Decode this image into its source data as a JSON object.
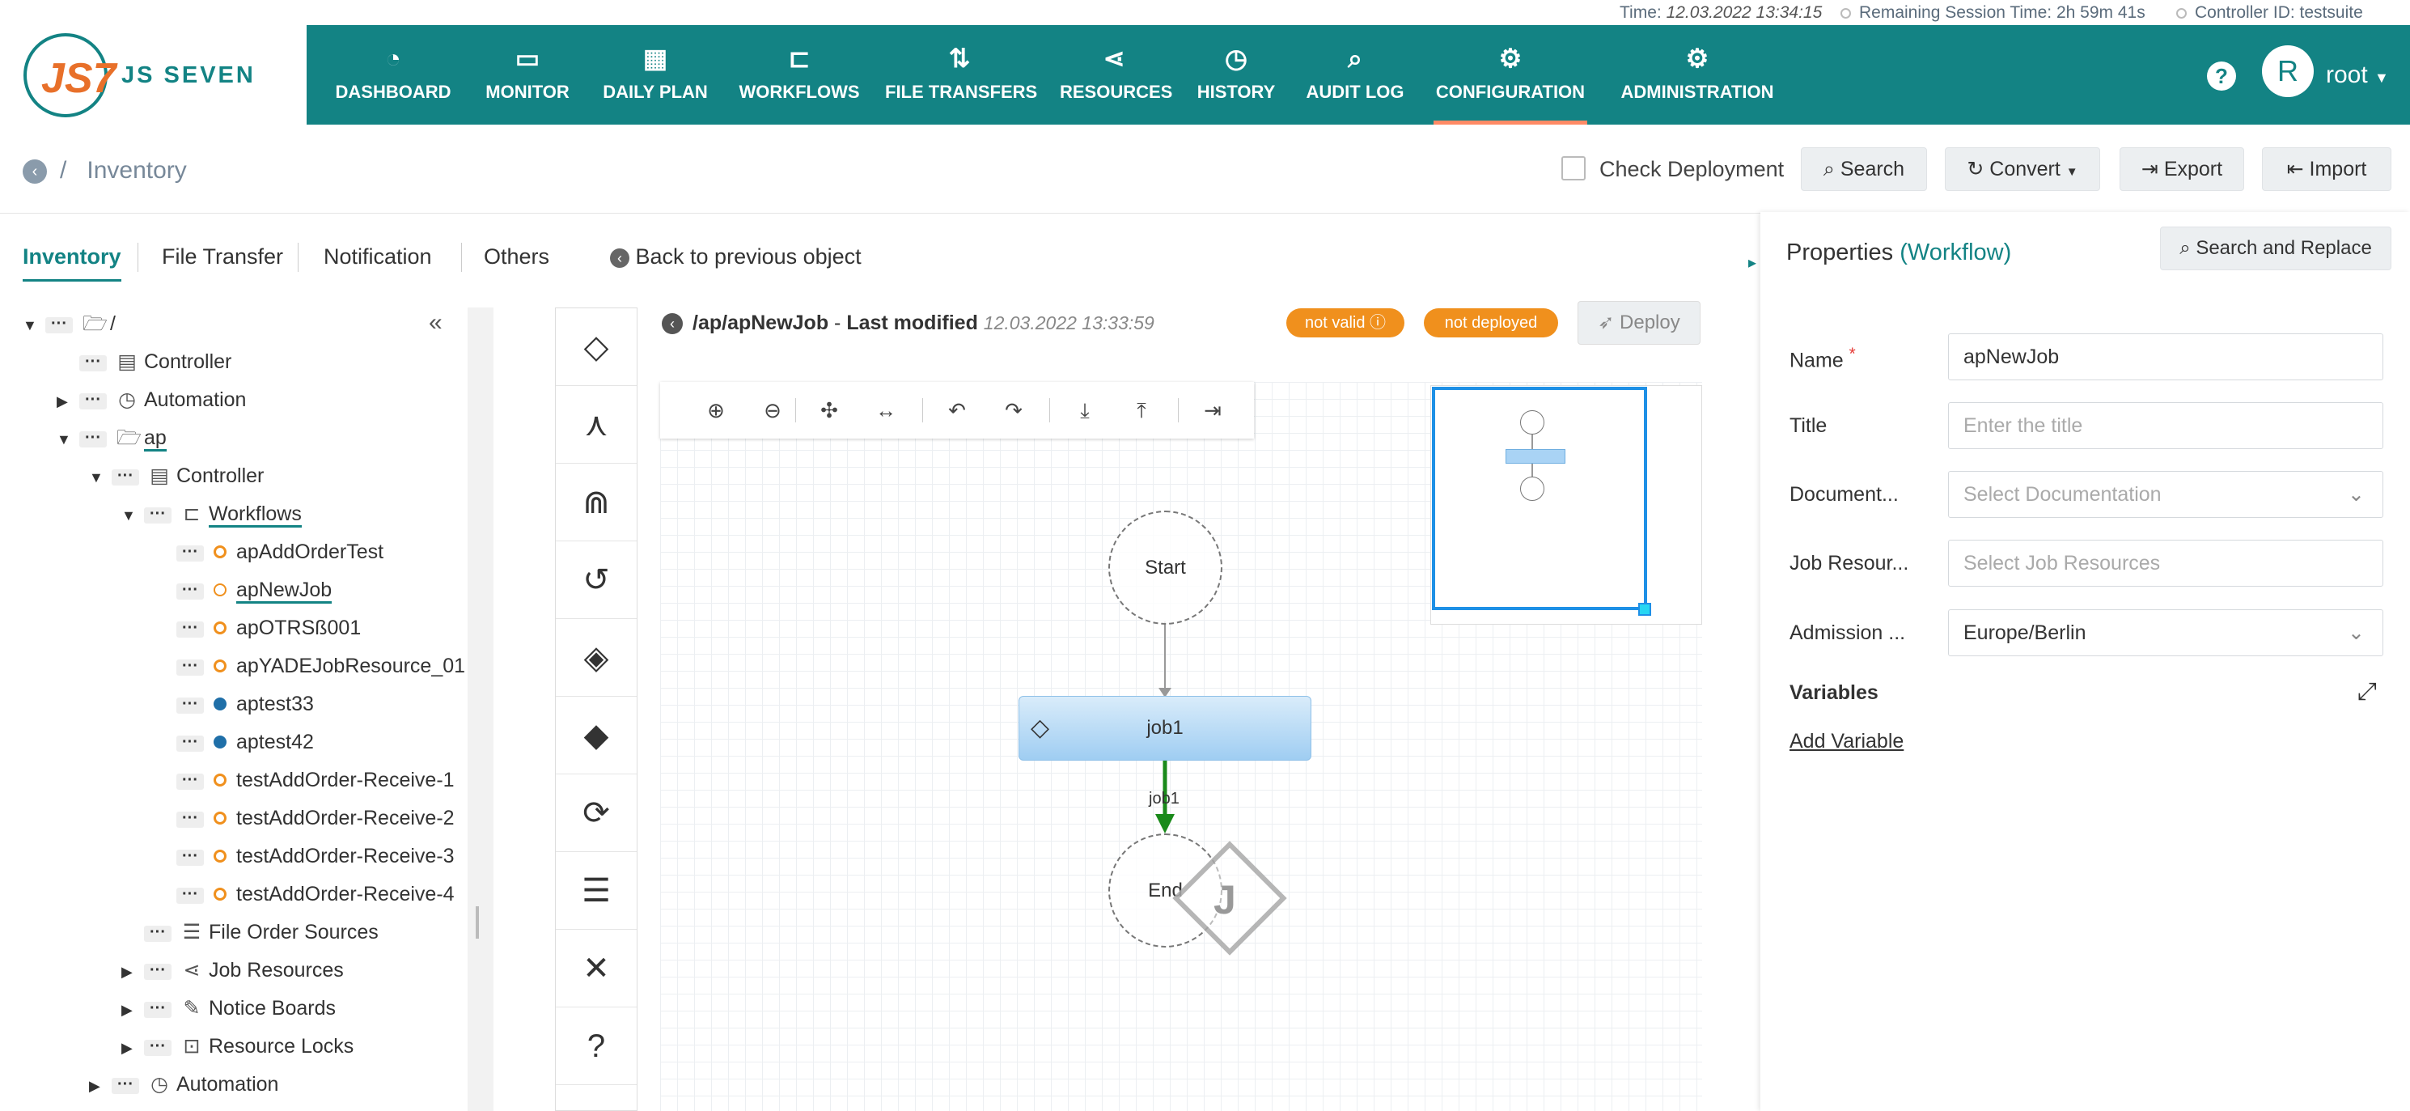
{
  "status_bar": {
    "time_label": "Time:",
    "time_value": "12.03.2022 13:34:15",
    "session_label": "Remaining Session Time:",
    "session_value": "2h 59m 41s",
    "controller_label": "Controller ID:",
    "controller_value": "testsuite"
  },
  "brand": {
    "logo_text": "JS7",
    "name": "JS SEVEN"
  },
  "nav": [
    {
      "label": "DASHBOARD",
      "icon": "dashboard-icon"
    },
    {
      "label": "MONITOR",
      "icon": "monitor-icon"
    },
    {
      "label": "DAILY PLAN",
      "icon": "calendar-icon"
    },
    {
      "label": "WORKFLOWS",
      "icon": "workflows-icon"
    },
    {
      "label": "FILE TRANSFERS",
      "icon": "transfer-icon"
    },
    {
      "label": "RESOURCES",
      "icon": "share-icon"
    },
    {
      "label": "HISTORY",
      "icon": "clock-icon"
    },
    {
      "label": "AUDIT LOG",
      "icon": "audit-icon"
    },
    {
      "label": "CONFIGURATION",
      "icon": "gears-icon",
      "active": true
    },
    {
      "label": "ADMINISTRATION",
      "icon": "admin-icon"
    }
  ],
  "user": {
    "avatar_letter": "R",
    "name": "root"
  },
  "breadcrumb": {
    "separator": "/",
    "current": "Inventory"
  },
  "toolbar": {
    "check_deployment": "Check Deployment",
    "search": "Search",
    "convert": "Convert",
    "export": "Export",
    "import": "Import"
  },
  "tabs": [
    "Inventory",
    "File Transfer",
    "Notification",
    "Others"
  ],
  "back_link": "Back to previous object",
  "tree": [
    {
      "label": "/",
      "icon": "folder-open-icon"
    },
    {
      "label": "Controller",
      "icon": "controller-icon"
    },
    {
      "label": "Automation",
      "icon": "automation-icon"
    },
    {
      "label": "ap",
      "icon": "folder-open-icon"
    },
    {
      "label": "Controller",
      "icon": "controller-icon"
    },
    {
      "label": "Workflows",
      "icon": "workflows-icon"
    },
    {
      "label": "apAddOrderTest"
    },
    {
      "label": "apNewJob"
    },
    {
      "label": "apOTRSß001"
    },
    {
      "label": "apYADEJobResource_01"
    },
    {
      "label": "aptest33"
    },
    {
      "label": "aptest42"
    },
    {
      "label": "testAddOrder-Receive-1"
    },
    {
      "label": "testAddOrder-Receive-2"
    },
    {
      "label": "testAddOrder-Receive-3"
    },
    {
      "label": "testAddOrder-Receive-4"
    },
    {
      "label": "File Order Sources",
      "icon": "file-order-icon"
    },
    {
      "label": "Job Resources",
      "icon": "share-icon"
    },
    {
      "label": "Notice Boards",
      "icon": "pin-icon"
    },
    {
      "label": "Resource Locks",
      "icon": "lock-icon"
    },
    {
      "label": "Automation",
      "icon": "automation-icon"
    }
  ],
  "status_colors": {
    "not_deployed": "#f0901d",
    "deployed": "#1f6fa8"
  },
  "workflow": {
    "path": "/ap/apNewJob",
    "separator": "-",
    "modified_label": "Last modified",
    "modified_value": "12.03.2022 13:33:59",
    "badge_valid": "not valid",
    "badge_deployed": "not deployed",
    "deploy": "Deploy"
  },
  "graph": {
    "start": "Start",
    "job": "job1",
    "edge_label": "job1",
    "end": "End"
  },
  "properties": {
    "title": "Properties",
    "type": "(Workflow)",
    "search_replace": "Search and Replace",
    "name_label": "Name",
    "required_mark": "*",
    "name_value": "apNewJob",
    "title_label": "Title",
    "title_placeholder": "Enter the title",
    "doc_label": "Document...",
    "doc_placeholder": "Select Documentation",
    "jobres_label": "Job Resour...",
    "jobres_placeholder": "Select Job Resources",
    "admission_label": "Admission ...",
    "admission_value": "Europe/Berlin",
    "variables_label": "Variables",
    "add_variable": "Add Variable"
  }
}
